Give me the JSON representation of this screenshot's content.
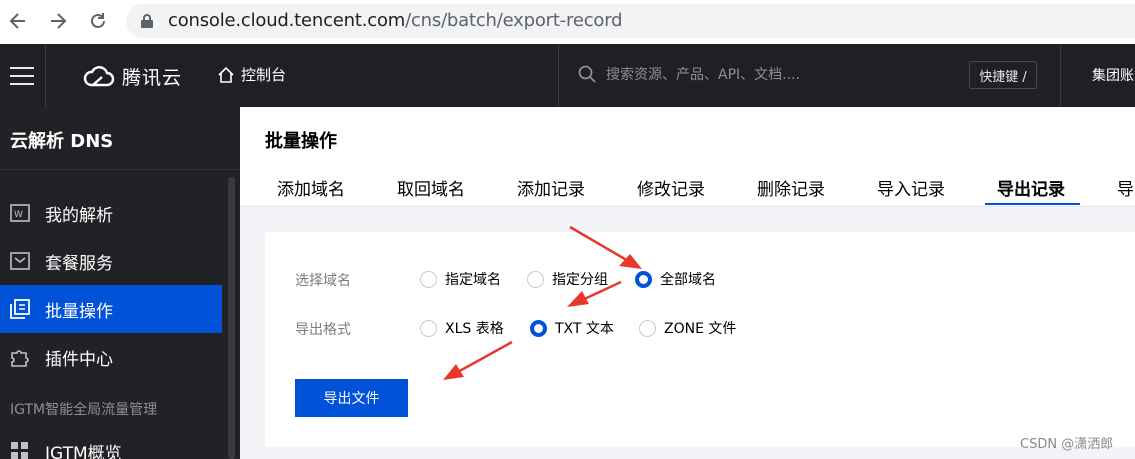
{
  "browser": {
    "url_host": "console.cloud.tencent.com",
    "url_path": "/cns/batch/export-record"
  },
  "topnav": {
    "brand": "腾讯云",
    "console": "控制台",
    "search_placeholder": "搜索资源、产品、API、文档....",
    "shortcut": "快捷键 /",
    "account": "集团账"
  },
  "sidebar": {
    "title": "云解析 DNS",
    "items": [
      {
        "label": "我的解析",
        "icon": "domain-list-icon"
      },
      {
        "label": "套餐服务",
        "icon": "package-icon"
      },
      {
        "label": "批量操作",
        "icon": "batch-icon"
      },
      {
        "label": "插件中心",
        "icon": "plugin-icon"
      }
    ],
    "group_label": "IGTM智能全局流量管理",
    "group_items": [
      {
        "label": "IGTM概览",
        "icon": "grid-icon"
      }
    ]
  },
  "main": {
    "title": "批量操作",
    "tabs": [
      "添加域名",
      "取回域名",
      "添加记录",
      "修改记录",
      "删除记录",
      "导入记录",
      "导出记录",
      "导"
    ],
    "active_tab": "导出记录",
    "form": {
      "domain_label": "选择域名",
      "domain_options": [
        "指定域名",
        "指定分组",
        "全部域名"
      ],
      "domain_selected": "全部域名",
      "format_label": "导出格式",
      "format_options": [
        "XLS 表格",
        "TXT 文本",
        "ZONE 文件"
      ],
      "format_selected": "TXT 文本",
      "export_button": "导出文件"
    }
  },
  "colors": {
    "accent": "#0052d9",
    "annotation_arrow": "#e8382c",
    "nav_bg": "#1f2023",
    "sidebar_bg": "#212226"
  },
  "watermark": "CSDN @潇洒郎"
}
